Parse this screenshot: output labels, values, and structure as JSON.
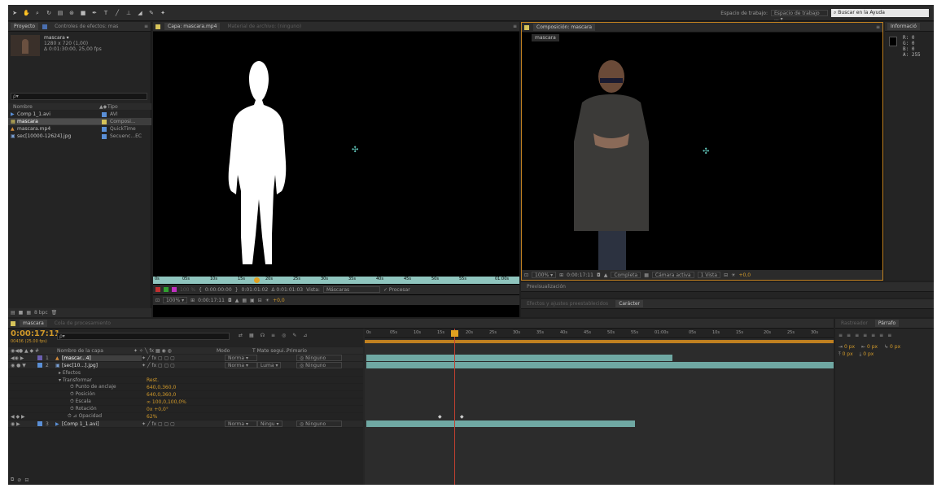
{
  "toolbar": {
    "workspace_label": "Espacio de trabajo:",
    "workspace_value": "Espacio de trabajo ...",
    "help_search": "Buscar en la Ayuda",
    "tool_icons": [
      "selection-arrow",
      "hand",
      "zoom",
      "rotate",
      "camera",
      "pan-behind",
      "pen",
      "text",
      "brush",
      "stamp",
      "eraser",
      "roto-brush",
      "puppet"
    ]
  },
  "project": {
    "tabs": [
      "Proyecto",
      "Controles de efectos: mas"
    ],
    "preview_name": "mascara ▾",
    "preview_info1": "1280 x 720 (1,00)",
    "preview_info2": "Δ 0:01:30:00, 25,00 fps",
    "search_placeholder": "ρ▾",
    "columns": [
      "Nombre",
      "Tipo"
    ],
    "items": [
      {
        "name": "Comp 1_1.avi",
        "type": "AVI",
        "icon": "video-icon",
        "color": "#5a8fd6",
        "selected": false
      },
      {
        "name": "mascara",
        "type": "Composi...",
        "icon": "composition-icon",
        "color": "#d6c35a",
        "selected": true
      },
      {
        "name": "mascara.mp4",
        "type": "QuickTime",
        "icon": "quicktime-icon",
        "color": "#d08a3a",
        "selected": false
      },
      {
        "name": "sec[10000-12624].jpg",
        "type": "Secuenc...EC",
        "icon": "image-sequence-icon",
        "color": "#7aa0d6",
        "selected": false
      }
    ],
    "footer": "8 bpc"
  },
  "layer_viewer": {
    "tab": "Capa: mascara.mp4",
    "tab2": "Material de archivo: (ninguno)",
    "ruler": [
      "0s",
      "05s",
      "10s",
      "15s",
      "20s",
      "25s",
      "30s",
      "35s",
      "40s",
      "45s",
      "50s",
      "55s",
      "01:00s"
    ],
    "in_time": "0:00:00:00",
    "out_time": "0:01:01:02",
    "duration": "Δ 0:01:01:03",
    "view_label": "Vista:",
    "view_value": "Máscaras",
    "process_label": "✓ Procesar",
    "zoom": "100%",
    "time": "0:00:17:11",
    "exposure": "+0,0",
    "color_percent": "100 %"
  },
  "comp_viewer": {
    "tab": "Composición: mascara",
    "subtab": "mascara",
    "zoom": "100%",
    "time": "0:00:17:11",
    "resolution": "Completa",
    "camera": "Cámara activa",
    "views": "1 Vista",
    "exposure": "+0,0"
  },
  "info": {
    "tab": "Informació",
    "r": "R: 0",
    "g": "G: 0",
    "b": "B: 0",
    "a": "A: 255"
  },
  "preview_panel": {
    "tab": "Previsualización"
  },
  "effects_panel": {
    "tab": "Efectos y ajustes preestablecidos",
    "tab2": "Carácter"
  },
  "paragraph": {
    "tab1": "Rastreador",
    "tab2": "Párrafo",
    "px1": "0 px",
    "px2": "0 px",
    "px3": "0 px",
    "px4": "0 px",
    "px5": "0 px"
  },
  "timeline": {
    "tab1": "mascara",
    "tab2": "Cola de procesamiento",
    "timecode": "0:00:17:11",
    "timecode_sub": "00436 (25.00 fps)",
    "search_placeholder": "ρ▾",
    "col_name": "Nombre de la capa",
    "col_mode": "Modo",
    "col_matte": "T Mate segui...",
    "col_parent": "Primario",
    "ruler": [
      "0s",
      "05s",
      "10s",
      "15s",
      "20s",
      "25s",
      "30s",
      "35s",
      "40s",
      "45s",
      "50s",
      "55s",
      "01:00s",
      "05s",
      "10s",
      "15s",
      "20s",
      "25s",
      "30s"
    ],
    "layers": [
      {
        "num": "1",
        "name": "[mascar...4]",
        "mode": "Norma ▾",
        "matte": "",
        "parent": "Ninguno"
      },
      {
        "num": "2",
        "name": "[sec[10...].jpg]",
        "mode": "Norma ▾",
        "matte": "Luma ▾",
        "parent": "Ninguno"
      },
      {
        "num": "3",
        "name": "[Comp 1_1.avi]",
        "mode": "Norma ▾",
        "matte": "Ningu ▾",
        "parent": "Ninguno"
      }
    ],
    "effects_label": "Efectos",
    "transform_label": "Transformar",
    "reset_label": "Rest.",
    "props": [
      {
        "name": "Punto de anclaje",
        "value": "640,0,360,0"
      },
      {
        "name": "Posición",
        "value": "640,0,360,0"
      },
      {
        "name": "Escala",
        "value": "∞ 100,0,100,0%"
      },
      {
        "name": "Rotación",
        "value": "0x +0,0°"
      },
      {
        "name": "Opacidad",
        "value": "62%"
      }
    ]
  },
  "colors": {
    "accent": "#d29a2a",
    "track": "#6fa8a3",
    "playhead": "#c04030",
    "timecode": "#d29a2a"
  }
}
